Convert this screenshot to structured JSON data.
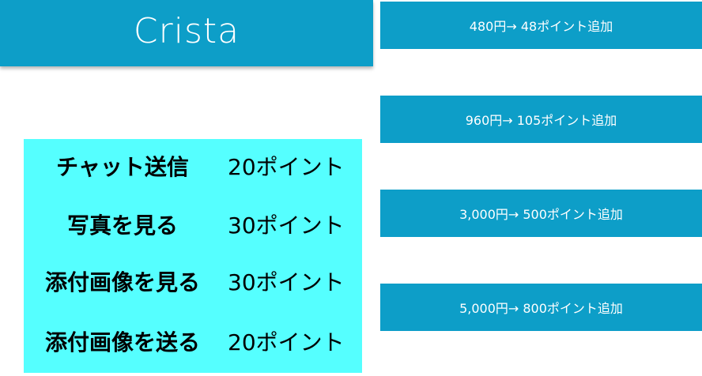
{
  "header": {
    "logo_text": "Crista"
  },
  "costs": [
    {
      "label": "チャット送信",
      "value": "20ポイント"
    },
    {
      "label": "写真を見る",
      "value": "30ポイント"
    },
    {
      "label": "添付画像を見る",
      "value": "30ポイント"
    },
    {
      "label": "添付画像を送る",
      "value": "20ポイント"
    }
  ],
  "plans": [
    {
      "label": "480円→ 48ポイント追加"
    },
    {
      "label": "960円→ 105ポイント追加"
    },
    {
      "label": "3,000円→ 500ポイント追加"
    },
    {
      "label": "5,000円→ 800ポイント追加"
    }
  ],
  "colors": {
    "brand": "#0d9ec8",
    "panel": "#55ffff"
  }
}
